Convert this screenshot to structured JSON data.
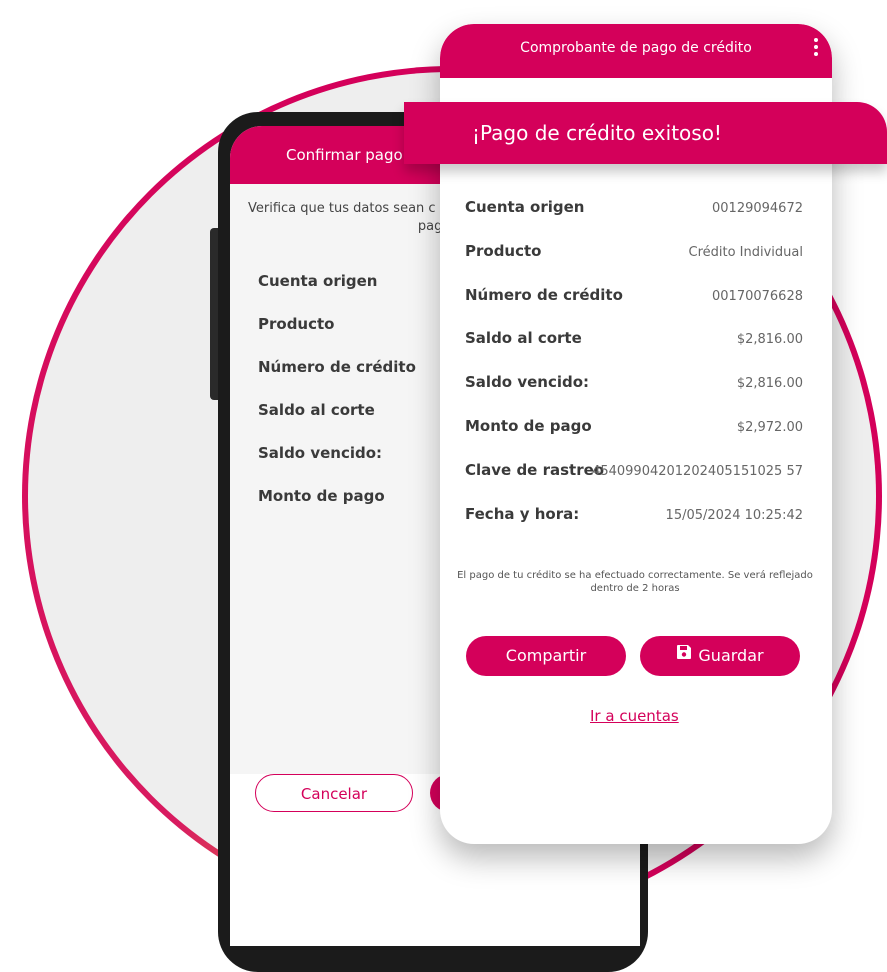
{
  "back_screen": {
    "title": "Confirmar pago de",
    "verify_line1": "Verifica que tus datos sean c",
    "verify_line2": "pago de c",
    "labels": [
      "Cuenta origen",
      "Producto",
      "Número de crédito",
      "Saldo al corte",
      "Saldo vencido:",
      "Monto de pago"
    ],
    "cancel_label": "Cancelar"
  },
  "receipt": {
    "title": "Comprobante de pago de crédito",
    "banner": "¡Pago de crédito exitoso!",
    "rows": [
      {
        "label": "Cuenta origen",
        "value": "00129094672"
      },
      {
        "label": "Producto",
        "value": "Crédito Individual"
      },
      {
        "label": "Número de crédito",
        "value": "00170076628"
      },
      {
        "label": "Saldo al corte",
        "value": "$2,816.00"
      },
      {
        "label": "Saldo vencido:",
        "value": "$2,816.00"
      },
      {
        "label": "Monto de pago",
        "value": "$2,972.00"
      },
      {
        "label": "Clave de rastreo",
        "value": "45409904201202405151025 57"
      },
      {
        "label": "Fecha y hora:",
        "value": "15/05/2024   10:25:42"
      }
    ],
    "note": "El pago de tu crédito se ha efectuado correctamente. Se verá reflejado dentro de 2 horas",
    "share_label": "Compartir",
    "save_label": "Guardar",
    "link_label": "Ir a cuentas"
  },
  "colors": {
    "brand": "#d4005a",
    "accent": "#e8b23a"
  },
  "icons": {
    "menu": "kebab-menu-icon",
    "save": "floppy-disk-icon"
  }
}
